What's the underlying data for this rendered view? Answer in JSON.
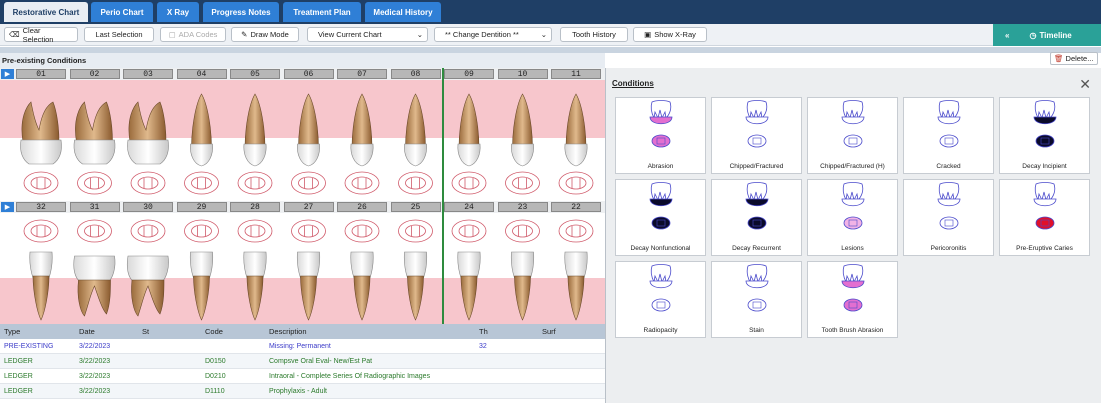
{
  "tabs": [
    {
      "label": "Restorative Chart",
      "active": true
    },
    {
      "label": "Perio Chart"
    },
    {
      "label": "X Ray"
    },
    {
      "label": "Progress Notes"
    },
    {
      "label": "Treatment Plan"
    },
    {
      "label": "Medical History"
    }
  ],
  "toolbar": {
    "clear_selection": "Clear Selection",
    "last_selection": "Last Selection",
    "ada_codes": "ADA Codes",
    "draw_mode": "Draw Mode",
    "view_current_chart": "View Current Chart",
    "change_dentition": "** Change Dentition **",
    "tooth_history": "Tooth History",
    "show_xray": "Show X-Ray",
    "timeline": "Timeline"
  },
  "section_title": "Pre-existing Conditions",
  "delete_label": "Delete...",
  "upper_numbers": [
    "01",
    "02",
    "03",
    "04",
    "05",
    "06",
    "07",
    "08",
    "09",
    "10",
    "11"
  ],
  "lower_numbers": [
    "32",
    "31",
    "30",
    "29",
    "28",
    "27",
    "26",
    "25",
    "24",
    "23",
    "22"
  ],
  "grid": {
    "headers": [
      "Type",
      "Date",
      "St",
      "Code",
      "Description",
      "Th",
      "Surf"
    ],
    "rows": [
      {
        "type": "PRE-EXISTING",
        "date": "3/22/2023",
        "st": "",
        "code": "",
        "description": "Missing: Permanent",
        "th": "32",
        "surf": "",
        "color": "#3a3ac8"
      },
      {
        "type": "LEDGER",
        "date": "3/22/2023",
        "st": "",
        "code": "D0150",
        "description": "Compsve Oral Eval- New/Est Pat",
        "th": "",
        "surf": "",
        "color": "#2b7a2b"
      },
      {
        "type": "LEDGER",
        "date": "3/22/2023",
        "st": "",
        "code": "D0210",
        "description": "Intraoral - Complete Series Of Radiographic Images",
        "th": "",
        "surf": "",
        "color": "#2b7a2b"
      },
      {
        "type": "LEDGER",
        "date": "3/22/2023",
        "st": "",
        "code": "D1110",
        "description": "Prophylaxis - Adult",
        "th": "",
        "surf": "",
        "color": "#2b7a2b"
      }
    ]
  },
  "conditions": {
    "title": "Conditions",
    "items": [
      {
        "label": "Abrasion",
        "crown": "#e36fd0",
        "occ": "#e36fd0"
      },
      {
        "label": "Chipped/Fractured",
        "crown": "#ffffff",
        "occ": "#ffffff"
      },
      {
        "label": "Chipped/Fractured (H)",
        "crown": "#ffffff",
        "occ": "#ffffff"
      },
      {
        "label": "Cracked",
        "crown": "#ffffff",
        "occ": "#ffffff"
      },
      {
        "label": "Decay Incipient",
        "crown": "#0a0a2a",
        "occ": "#0a0a2a"
      },
      {
        "label": "Decay Nonfunctional",
        "crown": "#0a0a2a",
        "occ": "#0a0a2a"
      },
      {
        "label": "Decay Recurrent",
        "crown": "#0a0a2a",
        "occ": "#0a0a2a"
      },
      {
        "label": "Lesions",
        "crown": "#ffffff",
        "occ": "#f2b3e6"
      },
      {
        "label": "Pericoronitis",
        "crown": "#ffffff",
        "occ": "#ffffff"
      },
      {
        "label": "Pre-Eruptive Caries",
        "crown": "#ffffff",
        "occ": "#e0102a"
      },
      {
        "label": "Radiopacity",
        "crown": "#ffffff",
        "occ": "#ffffff"
      },
      {
        "label": "Stain",
        "crown": "#ffffff",
        "occ": "#ffffff"
      },
      {
        "label": "Tooth Brush Abrasion",
        "crown": "#e36fd0",
        "occ": "#e36fd0"
      }
    ]
  }
}
